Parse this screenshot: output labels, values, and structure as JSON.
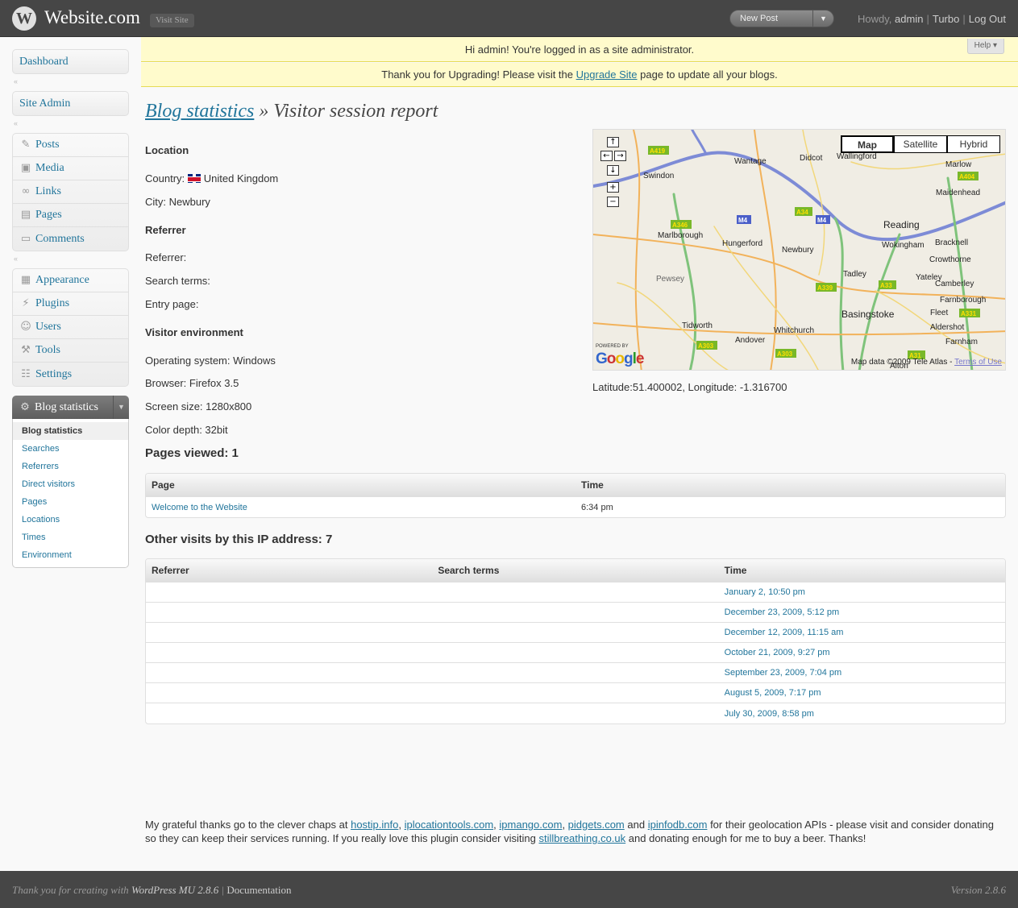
{
  "header": {
    "site_title": "Website.com",
    "visit_site": "Visit Site",
    "new_post": "New Post",
    "howdy": "Howdy,",
    "username": "admin",
    "turbo": "Turbo",
    "logout": "Log Out"
  },
  "notices": {
    "admin_notice": "Hi admin! You're logged in as a site administrator.",
    "help": "Help",
    "upgrade_prefix": "Thank you for Upgrading! Please visit the",
    "upgrade_link": "Upgrade Site",
    "upgrade_suffix": "page to update all your blogs."
  },
  "sidebar": {
    "dashboard": "Dashboard",
    "site_admin": "Site Admin",
    "posts": "Posts",
    "media": "Media",
    "links": "Links",
    "pages": "Pages",
    "comments": "Comments",
    "appearance": "Appearance",
    "plugins": "Plugins",
    "users": "Users",
    "tools": "Tools",
    "settings": "Settings",
    "blog_statistics": "Blog statistics",
    "submenu": [
      "Blog statistics",
      "Searches",
      "Referrers",
      "Direct visitors",
      "Pages",
      "Locations",
      "Times",
      "Environment"
    ]
  },
  "page": {
    "title_link": "Blog statistics",
    "title_rest": " » Visitor session report",
    "location_heading": "Location",
    "country_label": "Country:",
    "country_value": "United Kingdom",
    "city": "City: Newbury",
    "referrer_heading": "Referrer",
    "referrer": "Referrer:",
    "search_terms": "Search terms:",
    "entry_page": "Entry page:",
    "env_heading": "Visitor environment",
    "os": "Operating system: Windows",
    "browser": "Browser: Firefox 3.5",
    "screen": "Screen size: 1280x800",
    "color": "Color depth: 32bit"
  },
  "map": {
    "types": [
      "Map",
      "Satellite",
      "Hybrid"
    ],
    "powered_by": "POWERED BY",
    "google": "Google",
    "attribution": "Map data ©2009 Tele Atlas -",
    "terms": "Terms of Use",
    "latlong": "Latitude:51.400002, Longitude: -1.316700",
    "places": [
      "Swindon",
      "Wantage",
      "Didcot",
      "Wallingford",
      "Marlow",
      "Maidenhead",
      "Reading",
      "Marlborough",
      "Hungerford",
      "Newbury",
      "Wokingham",
      "Bracknell",
      "Pewsey",
      "Tadley",
      "Yateley",
      "Crowthorne",
      "Camberley",
      "Farnborough",
      "Basingstoke",
      "Fleet",
      "Aldershot",
      "Tidworth",
      "Whitchurch",
      "Andover",
      "Farnham",
      "Alton"
    ],
    "roads": [
      "A419",
      "M4",
      "A346",
      "A34",
      "M4",
      "A404",
      "A339",
      "A33",
      "A331",
      "A303",
      "A303",
      "A31"
    ]
  },
  "pages_viewed": {
    "title": "Pages viewed: 1",
    "headers": [
      "Page",
      "Time"
    ],
    "rows": [
      [
        "Welcome to the Website",
        "6:34 pm"
      ]
    ]
  },
  "other_visits": {
    "title": "Other visits by this IP address: 7",
    "headers": [
      "Referrer",
      "Search terms",
      "Time"
    ],
    "rows": [
      [
        "",
        "",
        "January 2, 10:50 pm"
      ],
      [
        "",
        "",
        "December 23, 2009, 5:12 pm"
      ],
      [
        "",
        "",
        "December 12, 2009, 11:15 am"
      ],
      [
        "",
        "",
        "October 21, 2009, 9:27 pm"
      ],
      [
        "",
        "",
        "September 23, 2009, 7:04 pm"
      ],
      [
        "",
        "",
        "August 5, 2009, 7:17 pm"
      ],
      [
        "",
        "",
        "July 30, 2009, 8:58 pm"
      ]
    ]
  },
  "thanks": {
    "t1": "My grateful thanks go to the clever chaps at",
    "l1": "hostip.info",
    "l2": "iplocationtools.com",
    "l3": "ipmango.com",
    "l4": "pidgets.com",
    "t2": "and",
    "l5": "ipinfodb.com",
    "t3": "for their geolocation APIs - please visit and consider donating so they can keep their services running. If you really love this plugin consider visiting",
    "l6": "stillbreathing.co.uk",
    "t4": "and donating enough for me to buy a beer. Thanks!"
  },
  "footer": {
    "thanks": "Thank you for creating with",
    "wpmu": "WordPress MU 2.8.6",
    "documentation": "Documentation",
    "version": "Version 2.8.6"
  }
}
